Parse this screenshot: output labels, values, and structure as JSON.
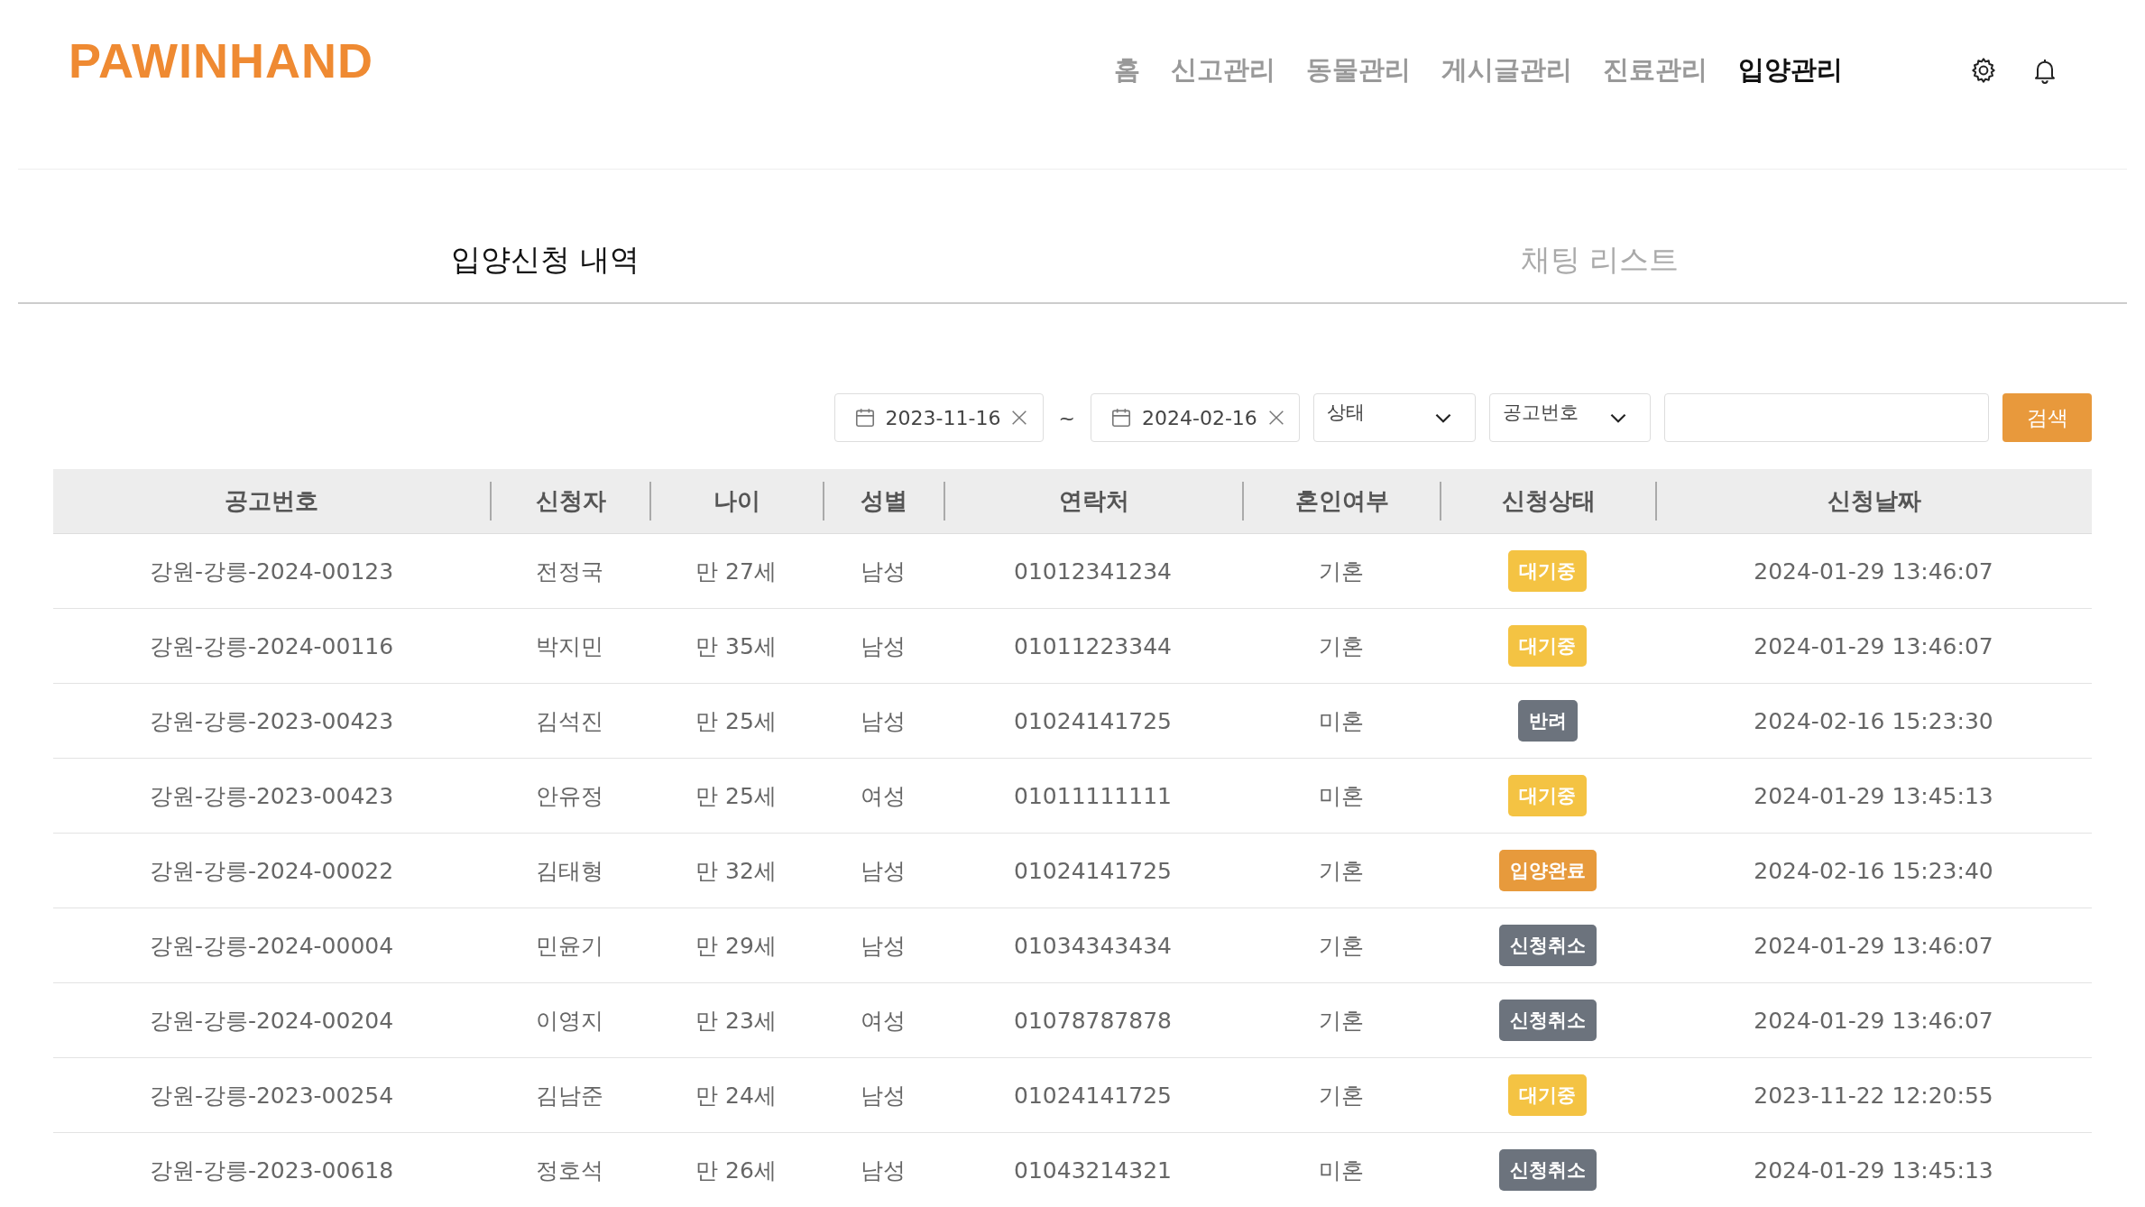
{
  "logo": "PAWINHAND",
  "nav": [
    {
      "label": "홈",
      "selected": false
    },
    {
      "label": "신고관리",
      "selected": false
    },
    {
      "label": "동물관리",
      "selected": false
    },
    {
      "label": "게시글관리",
      "selected": false
    },
    {
      "label": "진료관리",
      "selected": false
    },
    {
      "label": "입양관리",
      "selected": true
    }
  ],
  "tabs": [
    {
      "label": "입양신청 내역",
      "selected": true
    },
    {
      "label": "채팅 리스트",
      "selected": false
    }
  ],
  "filters": {
    "start_date": "2023-11-16",
    "separator": "~",
    "end_date": "2024-02-16",
    "status_select": "상태",
    "field_select": "공고번호",
    "search_button": "검색"
  },
  "table": {
    "columns": [
      "공고번호",
      "신청자",
      "나이",
      "성별",
      "연락처",
      "혼인여부",
      "신청상태",
      "신청날짜"
    ],
    "rows": [
      {
        "notice": "강원-강릉-2024-00123",
        "applicant": "전정국",
        "age": "만 27세",
        "gender": "남성",
        "phone": "01012341234",
        "marital": "기혼",
        "status": {
          "label": "대기중",
          "kind": "waiting"
        },
        "date": "2024-01-29 13:46:07"
      },
      {
        "notice": "강원-강릉-2024-00116",
        "applicant": "박지민",
        "age": "만 35세",
        "gender": "남성",
        "phone": "01011223344",
        "marital": "기혼",
        "status": {
          "label": "대기중",
          "kind": "waiting"
        },
        "date": "2024-01-29 13:46:07"
      },
      {
        "notice": "강원-강릉-2023-00423",
        "applicant": "김석진",
        "age": "만 25세",
        "gender": "남성",
        "phone": "01024141725",
        "marital": "미혼",
        "status": {
          "label": "반려",
          "kind": "rejected"
        },
        "date": "2024-02-16 15:23:30"
      },
      {
        "notice": "강원-강릉-2023-00423",
        "applicant": "안유정",
        "age": "만 25세",
        "gender": "여성",
        "phone": "01011111111",
        "marital": "미혼",
        "status": {
          "label": "대기중",
          "kind": "waiting"
        },
        "date": "2024-01-29 13:45:13"
      },
      {
        "notice": "강원-강릉-2024-00022",
        "applicant": "김태형",
        "age": "만 32세",
        "gender": "남성",
        "phone": "01024141725",
        "marital": "기혼",
        "status": {
          "label": "입양완료",
          "kind": "completed"
        },
        "date": "2024-02-16 15:23:40"
      },
      {
        "notice": "강원-강릉-2024-00004",
        "applicant": "민윤기",
        "age": "만 29세",
        "gender": "남성",
        "phone": "01034343434",
        "marital": "기혼",
        "status": {
          "label": "신청취소",
          "kind": "cancelled"
        },
        "date": "2024-01-29 13:46:07"
      },
      {
        "notice": "강원-강릉-2024-00204",
        "applicant": "이영지",
        "age": "만 23세",
        "gender": "여성",
        "phone": "01078787878",
        "marital": "기혼",
        "status": {
          "label": "신청취소",
          "kind": "cancelled"
        },
        "date": "2024-01-29 13:46:07"
      },
      {
        "notice": "강원-강릉-2023-00254",
        "applicant": "김남준",
        "age": "만 24세",
        "gender": "남성",
        "phone": "01024141725",
        "marital": "기혼",
        "status": {
          "label": "대기중",
          "kind": "waiting"
        },
        "date": "2023-11-22 12:20:55"
      },
      {
        "notice": "강원-강릉-2023-00618",
        "applicant": "정호석",
        "age": "만 26세",
        "gender": "남성",
        "phone": "01043214321",
        "marital": "미혼",
        "status": {
          "label": "신청취소",
          "kind": "cancelled"
        },
        "date": "2024-01-29 13:45:13"
      }
    ]
  }
}
